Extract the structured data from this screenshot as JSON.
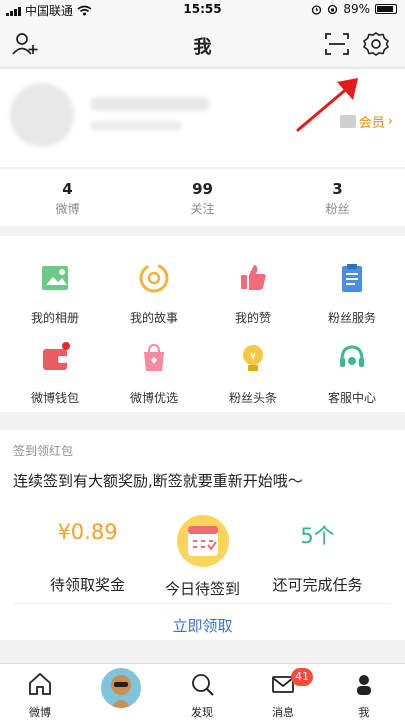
{
  "status_bar": {
    "carrier": "中国联通",
    "time": "15:55",
    "battery": "89%"
  },
  "nav": {
    "title": "我"
  },
  "profile": {
    "vip_label": "会员"
  },
  "stats": [
    {
      "value": "4",
      "label": "微博"
    },
    {
      "value": "99",
      "label": "关注"
    },
    {
      "value": "3",
      "label": "粉丝"
    }
  ],
  "grid": [
    {
      "label": "我的相册",
      "icon": "photo-album-icon"
    },
    {
      "label": "我的故事",
      "icon": "story-icon"
    },
    {
      "label": "我的赞",
      "icon": "thumb-up-icon"
    },
    {
      "label": "粉丝服务",
      "icon": "clipboard-icon"
    },
    {
      "label": "微博钱包",
      "icon": "wallet-icon"
    },
    {
      "label": "微博优选",
      "icon": "shopping-bag-icon"
    },
    {
      "label": "粉丝头条",
      "icon": "bulb-icon"
    },
    {
      "label": "客服中心",
      "icon": "headset-icon"
    }
  ],
  "checkin": {
    "title": "签到领红包",
    "promo": "连续签到有大额奖励,断签就要重新开始哦～",
    "reward_value": "¥0.89",
    "reward_label": "待领取奖金",
    "today_label": "今日待签到",
    "tasks_value": "5个",
    "tasks_label": "还可完成任务",
    "claim_label": "立即领取"
  },
  "tabs": [
    {
      "label": "微博",
      "icon": "home-icon"
    },
    {
      "label": "",
      "icon": "avatar-icon"
    },
    {
      "label": "发现",
      "icon": "search-icon"
    },
    {
      "label": "消息",
      "icon": "mail-icon",
      "badge": "41"
    },
    {
      "label": "我",
      "icon": "profile-icon"
    }
  ],
  "colors": {
    "accent_blue": "#3f72c8",
    "reward_orange": "#f4a227",
    "task_green": "#34b48a",
    "vip_orange": "#ef8a00",
    "badge_red": "#f24e3a"
  }
}
